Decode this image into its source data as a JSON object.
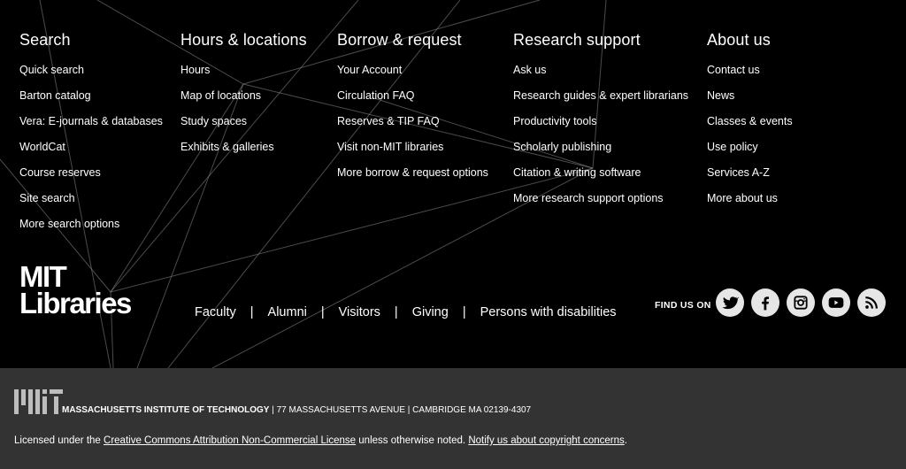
{
  "columns": {
    "search": {
      "title": "Search",
      "links": [
        "Quick search",
        "Barton catalog",
        "Vera: E-journals & databases",
        "WorldCat",
        "Course reserves",
        "Site search",
        "More search options"
      ]
    },
    "hours": {
      "title": "Hours & locations",
      "links": [
        "Hours",
        "Map of locations",
        "Study spaces",
        "Exhibits & galleries"
      ]
    },
    "borrow": {
      "title": "Borrow & request",
      "links": [
        "Your Account",
        "Circulation FAQ",
        "Reserves & TIP FAQ",
        "Visit non-MIT libraries",
        "More borrow & request options"
      ]
    },
    "research": {
      "title": "Research support",
      "links": [
        "Ask us",
        "Research guides & expert librarians",
        "Productivity tools",
        "Scholarly publishing",
        "Citation & writing software",
        "More research support options"
      ]
    },
    "about": {
      "title": "About us",
      "links": [
        "Contact us",
        "News",
        "Classes & events",
        "Use policy",
        "Services A-Z",
        "More about us"
      ]
    }
  },
  "logo": {
    "line1": "MIT",
    "line2": "Libraries"
  },
  "audience": {
    "links": [
      "Faculty",
      "Alumni",
      "Visitors",
      "Giving",
      "Persons with disabilities"
    ],
    "separator": "|"
  },
  "social": {
    "label": "FIND US ON",
    "icons": [
      "twitter-icon",
      "facebook-icon",
      "instagram-icon",
      "youtube-icon",
      "rss-icon"
    ]
  },
  "bottom": {
    "institute": "MASSACHUSETTS INSTITUTE OF TECHNOLOGY",
    "address": " | 77 MASSACHUSETTS AVENUE | CAMBRIDGE MA 02139-4307",
    "license_prefix": "Licensed under the ",
    "license_link": "Creative Commons Attribution Non-Commercial License",
    "license_middle": " unless otherwise noted. ",
    "copyright_link": "Notify us about copyright concerns",
    "license_suffix": "."
  },
  "colors": {
    "main_bg": "#000000",
    "bottom_bg": "#333333",
    "icon_bg": "#e6e6e6",
    "line": "#8a8a8a"
  }
}
